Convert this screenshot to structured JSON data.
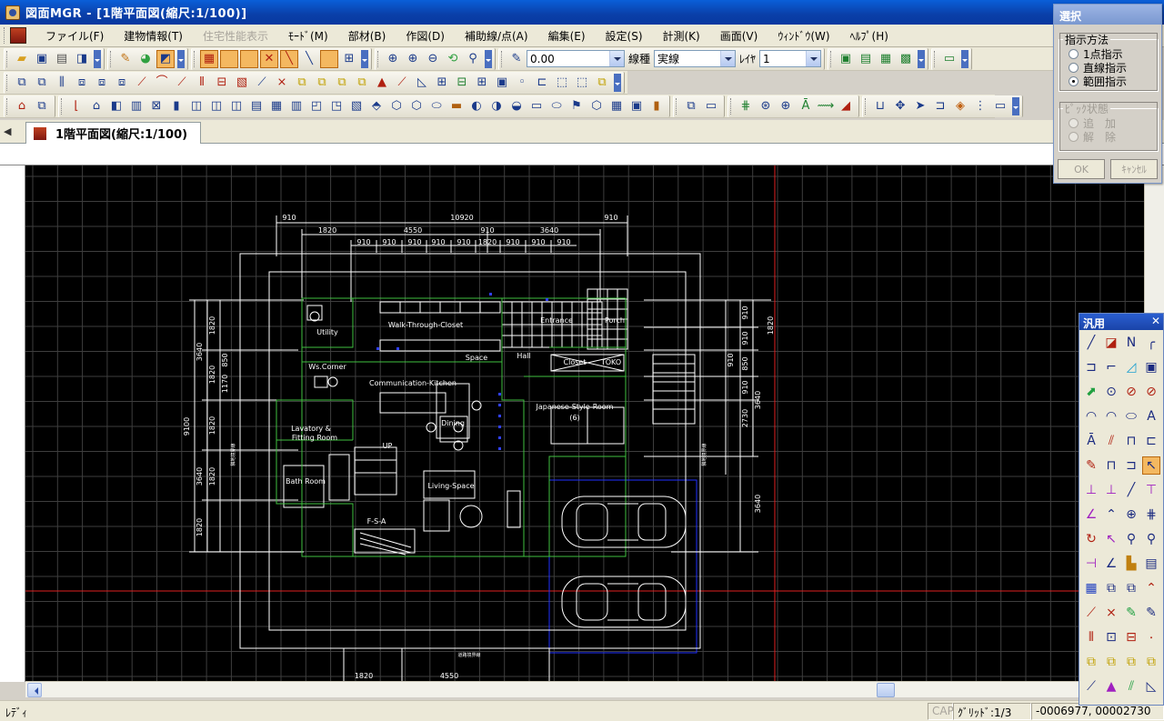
{
  "window": {
    "title": "図面MGR - [1階平面図(縮尺:1/100)]"
  },
  "menu": [
    {
      "label": "ファイル(F)",
      "enabled": true
    },
    {
      "label": "建物情報(T)",
      "enabled": true
    },
    {
      "label": "住宅性能表示",
      "enabled": false
    },
    {
      "label": "ﾓｰﾄﾞ(M)",
      "enabled": true
    },
    {
      "label": "部材(B)",
      "enabled": true
    },
    {
      "label": "作図(D)",
      "enabled": true
    },
    {
      "label": "補助線/点(A)",
      "enabled": true
    },
    {
      "label": "編集(E)",
      "enabled": true
    },
    {
      "label": "設定(S)",
      "enabled": true
    },
    {
      "label": "計測(K)",
      "enabled": true
    },
    {
      "label": "画面(V)",
      "enabled": true
    },
    {
      "label": "ｳｨﾝﾄﾞｳ(W)",
      "enabled": true
    },
    {
      "label": "ﾍﾙﾌﾟ(H)",
      "enabled": true
    }
  ],
  "toolbar": {
    "line_width_value": "0.00",
    "line_type_label": "線種",
    "line_type_value": "実線",
    "layer_label": "ﾚｲﾔ",
    "layer_value": "1"
  },
  "tab": {
    "label": "1階平面図(縮尺:1/100)"
  },
  "select_dialog": {
    "title": "選択",
    "method_group": "指示方法",
    "methods": [
      {
        "label": "1点指示",
        "selected": false
      },
      {
        "label": "直線指示",
        "selected": false
      },
      {
        "label": "範囲指示",
        "selected": true
      }
    ],
    "pick_group": "ﾋﾟｯｸ状態",
    "pick_states": [
      "追　加",
      "解　除"
    ],
    "ok_label": "OK",
    "cancel_label": "ｷｬﾝｾﾙ"
  },
  "palette": {
    "title": "汎用"
  },
  "status": {
    "ready": "ﾚﾃﾞｨ",
    "cap": "CAP",
    "grid": "ｸﾞﾘｯﾄﾞ:1/3",
    "coords": "-0006977, 00002730"
  },
  "drawing": {
    "dims_top": [
      "910",
      "10920",
      "910",
      "1820",
      "4550",
      "910",
      "3640",
      "910",
      "910",
      "910",
      "910",
      "910",
      "910",
      "910",
      "910",
      "1820"
    ],
    "dims_bottom": [
      "1820",
      "4550"
    ],
    "dims_left_outer": [
      "3640",
      "9100",
      "3640",
      "1820"
    ],
    "dims_left_inner": [
      "1820",
      "1820",
      "850",
      "1170",
      "1820",
      "1820"
    ],
    "dims_right": [
      "910",
      "910",
      "850",
      "910",
      "910",
      "2730",
      "3640",
      "3640",
      "1820"
    ],
    "room_labels": [
      "Utility",
      "Walk-Through-Closet",
      "Entrance",
      "Porch",
      "Ws.Corner",
      "Space",
      "Hall",
      "Closet",
      "TOKO",
      "Communication-Kitchen",
      "Japanese-Style-Room",
      "(6)",
      "Lavatory &",
      "Fitting Room",
      "Dining",
      "UP",
      "Bath Room",
      "Living-Space",
      "F-S-A"
    ],
    "side_labels": [
      "隣地境界線",
      "隣地境界線",
      "道路境界線"
    ]
  }
}
